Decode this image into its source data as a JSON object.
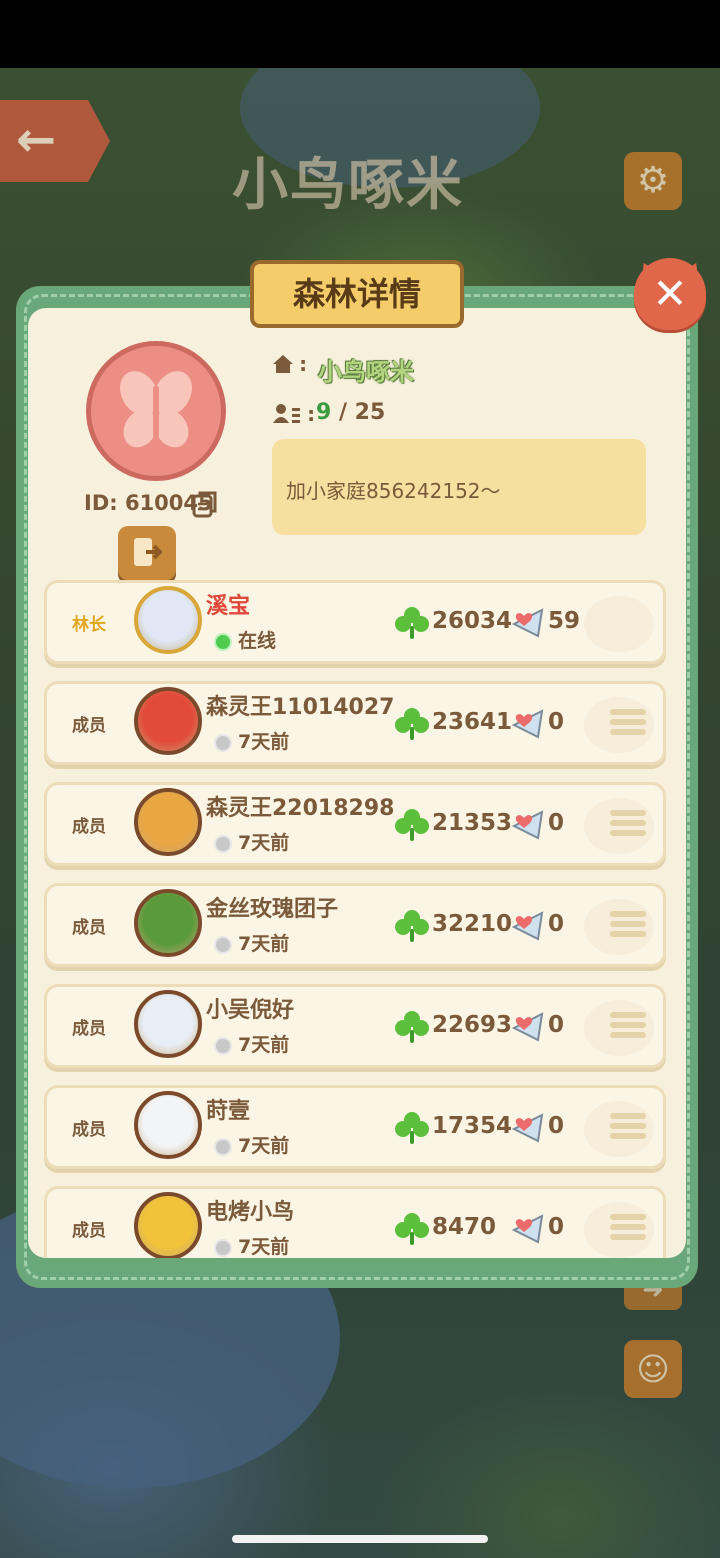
{
  "game": {
    "title": "小鸟啄米",
    "back_icon": "arrow-left-icon",
    "settings_icon": "gear-icon"
  },
  "dialog": {
    "title": "森林详情",
    "close_icon": "close-icon",
    "forest": {
      "name": "小鸟啄米",
      "id_label": "ID: 610045",
      "members_current": "9",
      "members_sep": " / ",
      "members_max": "25",
      "notice": "加小家庭856242152～",
      "emblem": "butterfly-emblem-icon"
    },
    "members": [
      {
        "role": "林长",
        "name": "溪宝",
        "status": "在线",
        "online": true,
        "score": "26034",
        "gifts": "59",
        "leader": true,
        "avatar_color": "#dfe8f4"
      },
      {
        "role": "成员",
        "name": "森灵王11014027",
        "status": "7天前",
        "online": false,
        "score": "23641",
        "gifts": "0",
        "leader": false,
        "avatar_color": "#e24b3a"
      },
      {
        "role": "成员",
        "name": "森灵王22018298",
        "status": "7天前",
        "online": false,
        "score": "21353",
        "gifts": "0",
        "leader": false,
        "avatar_color": "#e9a642"
      },
      {
        "role": "成员",
        "name": "金丝玫瑰团子",
        "status": "7天前",
        "online": false,
        "score": "32210",
        "gifts": "0",
        "leader": false,
        "avatar_color": "#5a9a3c"
      },
      {
        "role": "成员",
        "name": "小吴倪好",
        "status": "7天前",
        "online": false,
        "score": "22693",
        "gifts": "0",
        "leader": false,
        "avatar_color": "#e8eef6"
      },
      {
        "role": "成员",
        "name": "莳壹",
        "status": "7天前",
        "online": false,
        "score": "17354",
        "gifts": "0",
        "leader": false,
        "avatar_color": "#f2f4f6"
      },
      {
        "role": "成员",
        "name": "电烤小鸟",
        "status": "7天前",
        "online": false,
        "score": "8470",
        "gifts": "0",
        "leader": false,
        "avatar_color": "#f0c33a"
      }
    ]
  },
  "colors": {
    "dialog_frame": "#6aa879",
    "panel": "#f7f0dc",
    "title_plaque": "#f4cd6a",
    "leader_role": "#e0a820",
    "leader_name": "#e0483a",
    "online_dot": "#4fcc4f",
    "text_brown": "#7a5a3a"
  }
}
